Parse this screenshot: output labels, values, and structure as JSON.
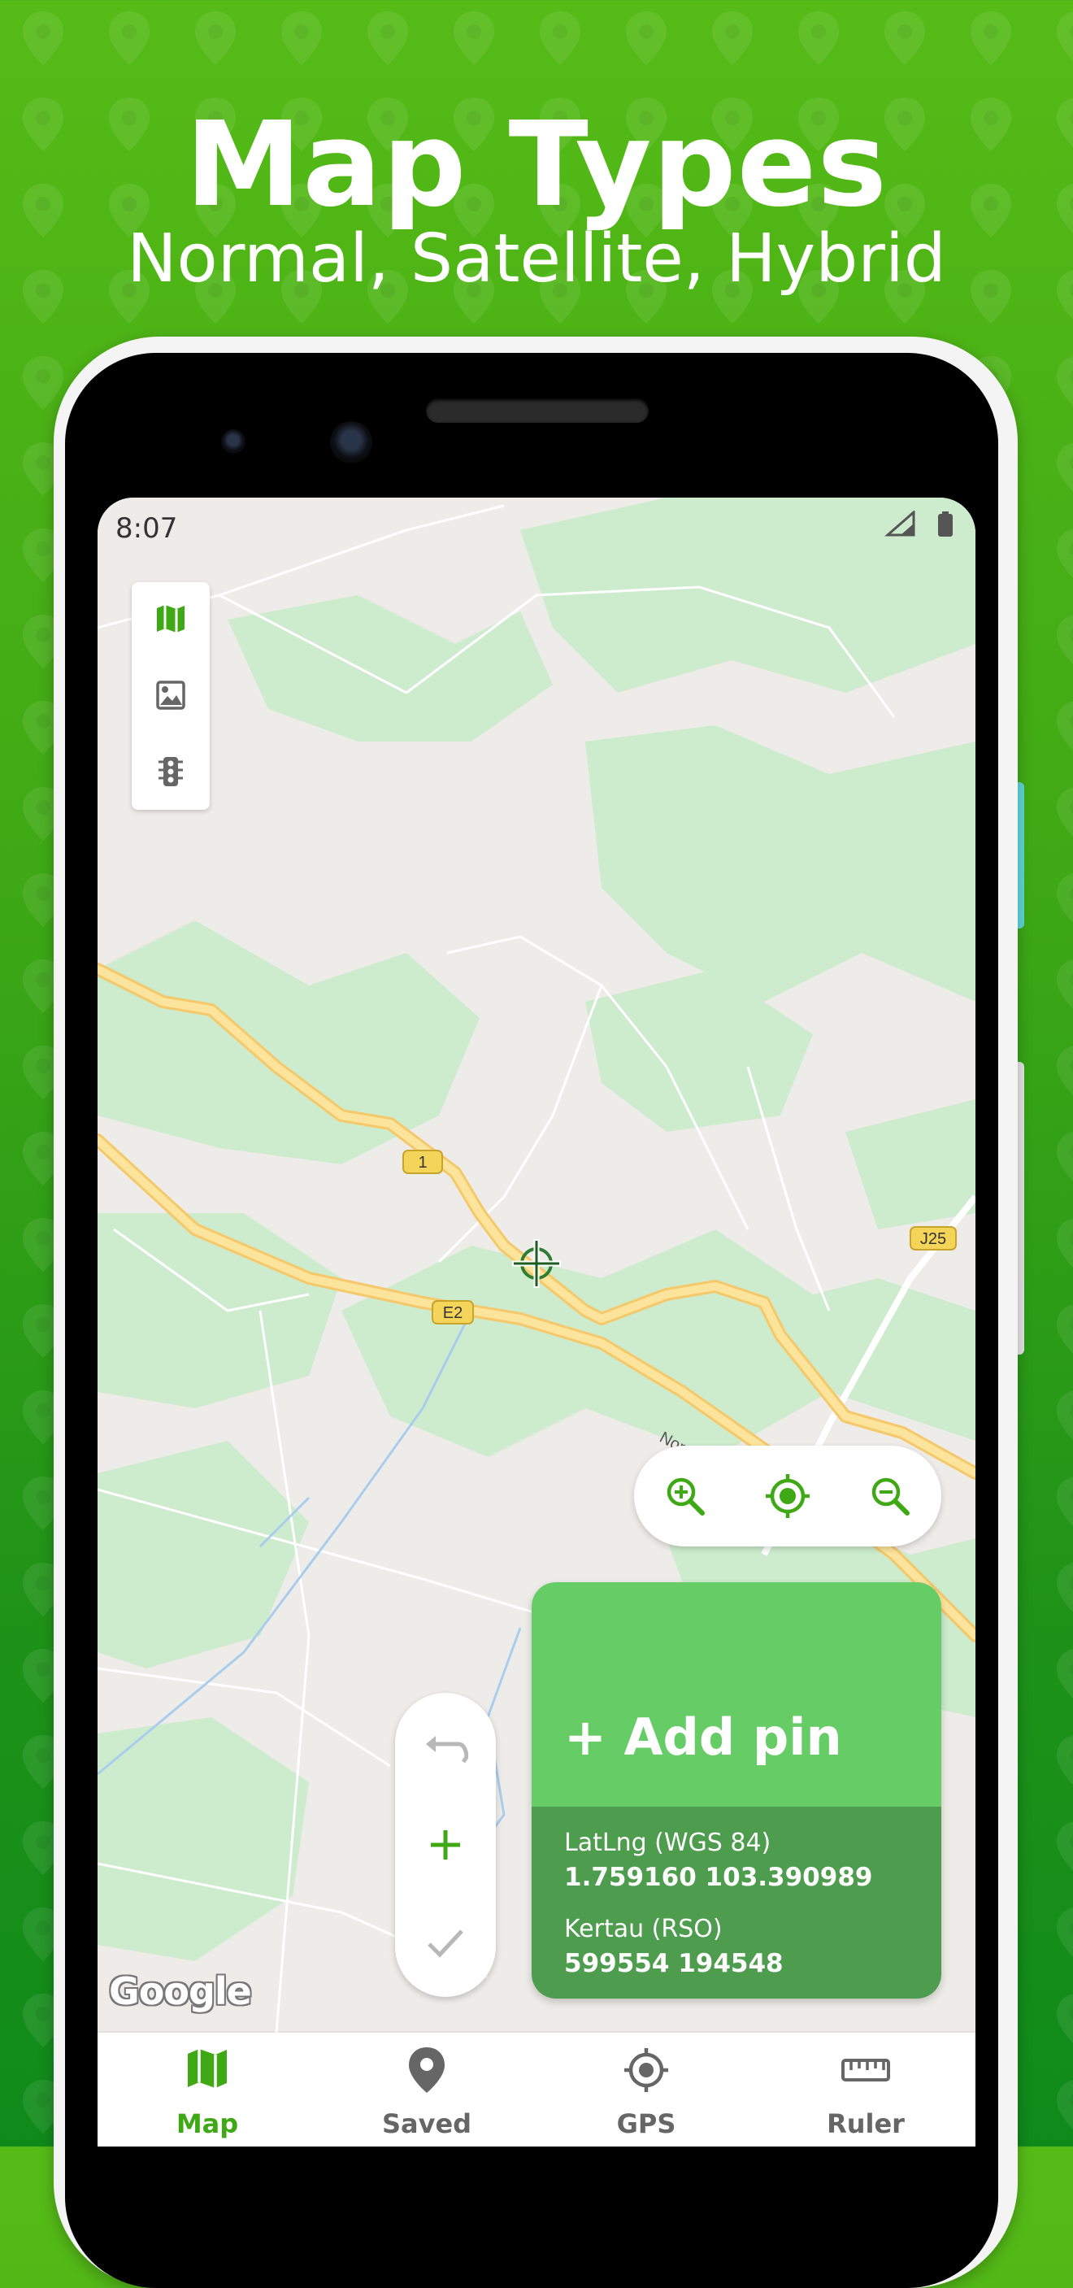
{
  "banner": {
    "title": "Map Types",
    "subtitle": "Normal, Satellite, Hybrid"
  },
  "status_bar": {
    "time": "8:07",
    "icons": [
      "signal-icon",
      "battery-icon"
    ]
  },
  "layer_controls": [
    {
      "name": "map-layer-icon",
      "active": true
    },
    {
      "name": "satellite-image-icon",
      "active": false
    },
    {
      "name": "traffic-light-icon",
      "active": false
    }
  ],
  "map": {
    "road_labels": [
      "1",
      "E2",
      "J25",
      "Nor"
    ],
    "attribution": "Google"
  },
  "zoom_controls": [
    "zoom-in-icon",
    "my-location-icon",
    "zoom-out-icon"
  ],
  "edit_controls": [
    "undo-icon",
    "add-icon",
    "check-icon"
  ],
  "pin_card": {
    "add_label": "+ Add pin",
    "wgs_label": "LatLng (WGS 84)",
    "wgs_value": "1.759160 103.390989",
    "rso_label": "Kertau (RSO)",
    "rso_value": "599554 194548"
  },
  "bottom_nav": [
    {
      "label": "Map",
      "icon": "map-icon",
      "active": true
    },
    {
      "label": "Saved",
      "icon": "pin-icon",
      "active": false
    },
    {
      "label": "GPS",
      "icon": "gps-icon",
      "active": false
    },
    {
      "label": "Ruler",
      "icon": "ruler-icon",
      "active": false
    }
  ],
  "colors": {
    "brand_green": "#3fa915",
    "card_green": "#66cc66",
    "card_dark_green": "#4e9c4e",
    "road_yellow": "#fbd97a",
    "park_green": "#cdeccd",
    "map_background": "#eeece8"
  }
}
